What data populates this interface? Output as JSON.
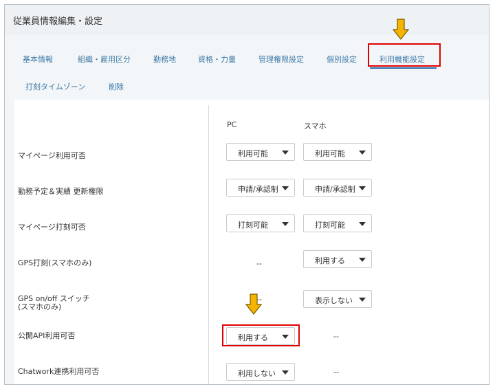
{
  "page_title": "従業員情報編集・設定",
  "tabs": [
    "基本情報",
    "組織・雇用区分",
    "勤務地",
    "資格・力量",
    "管理権限設定",
    "個別設定",
    "利用機能設定",
    "打刻タイムゾーン",
    "削除"
  ],
  "columns": {
    "pc": "PC",
    "smartphone": "スマホ"
  },
  "rows": [
    {
      "label": "マイページ利用可否",
      "pc": "利用可能",
      "sp": "利用可能"
    },
    {
      "label": "勤務予定＆実績 更新権限",
      "pc": "申請/承認制",
      "sp": "申請/承認制"
    },
    {
      "label": "マイページ打刻可否",
      "pc": "打刻可能",
      "sp": "打刻可能"
    },
    {
      "label": "GPS打刻(スマホのみ)",
      "pc": "--",
      "sp": "利用する"
    },
    {
      "label_line1": "GPS on/off スイッチ",
      "label_line2": "(スマホのみ)",
      "pc": "--",
      "sp": "表示しない"
    },
    {
      "label": "公開API利用可否",
      "pc": "利用する",
      "sp": "--"
    },
    {
      "label": "Chatwork連携利用可否",
      "pc": "利用しない",
      "sp": "--"
    }
  ],
  "colors": {
    "highlight": "#e00000",
    "arrow": "#f5b400",
    "tab_text": "#3c78a6"
  }
}
